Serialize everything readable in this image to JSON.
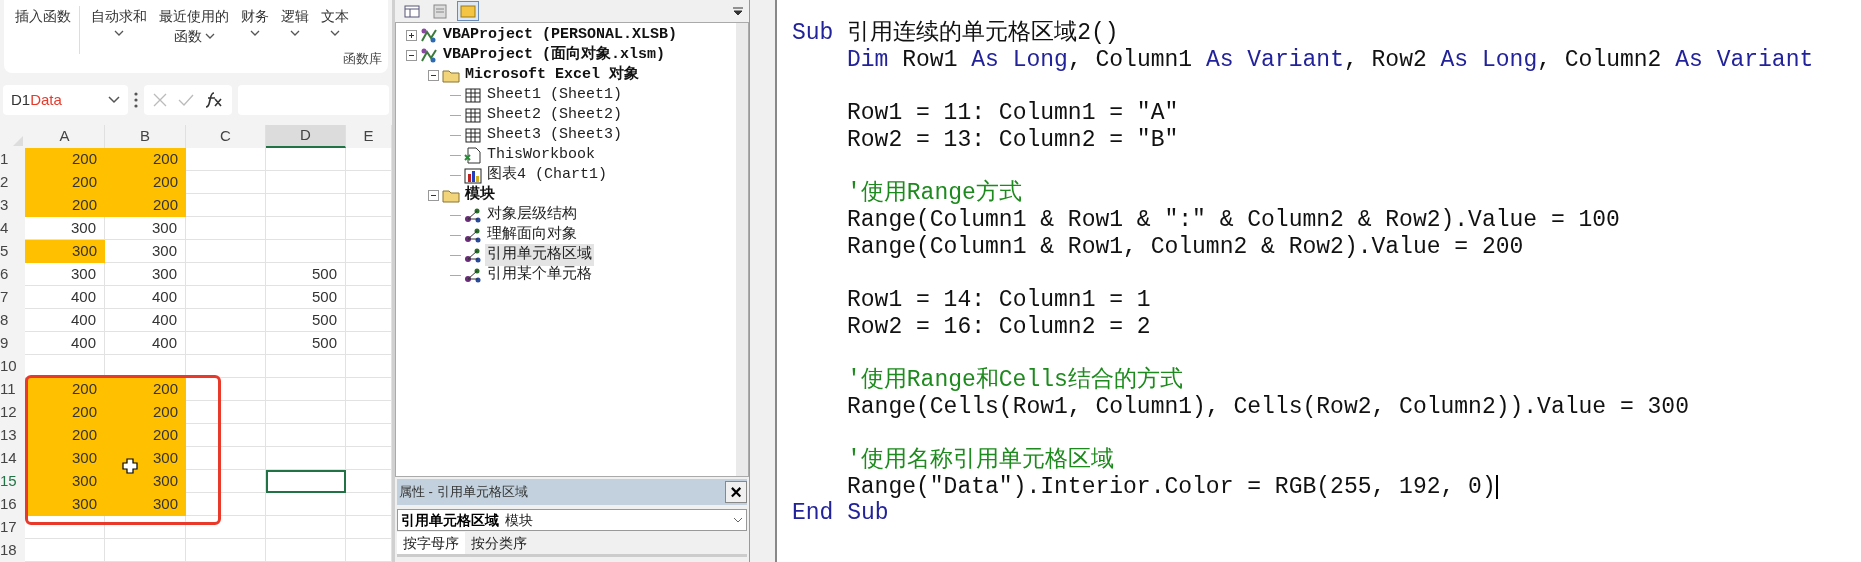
{
  "ribbon": {
    "items": [
      {
        "lines": [
          "插入函数"
        ],
        "dropdown": false
      },
      {
        "lines": [
          "自动求和"
        ],
        "dropdown": true
      },
      {
        "lines": [
          "最近使用的",
          "函数"
        ],
        "dropdown": true
      },
      {
        "lines": [
          "财务"
        ],
        "dropdown": true
      },
      {
        "lines": [
          "逻辑"
        ],
        "dropdown": true
      },
      {
        "lines": [
          "文本"
        ],
        "dropdown": true
      }
    ],
    "group_label": "函数库"
  },
  "name_box": {
    "value": "D1",
    "annotation": "Data"
  },
  "sheet": {
    "columns": [
      {
        "label": "A",
        "selected": false
      },
      {
        "label": "B",
        "selected": false
      },
      {
        "label": "C",
        "selected": false
      },
      {
        "label": "D",
        "selected": true
      },
      {
        "label": "E",
        "selected": false
      }
    ],
    "rows": [
      {
        "label": "1",
        "selected": false,
        "cells": [
          {
            "value": "200",
            "highlighted": true,
            "selected": false
          },
          {
            "value": "200",
            "highlighted": true,
            "selected": false
          },
          {
            "highlighted": false,
            "selected": false
          },
          {
            "highlighted": false,
            "selected": false
          },
          {
            "highlighted": false,
            "selected": false
          }
        ]
      },
      {
        "label": "2",
        "selected": false,
        "cells": [
          {
            "value": "200",
            "highlighted": true,
            "selected": false
          },
          {
            "value": "200",
            "highlighted": true,
            "selected": false
          },
          {
            "highlighted": false,
            "selected": false
          },
          {
            "highlighted": false,
            "selected": false
          },
          {
            "highlighted": false,
            "selected": false
          }
        ]
      },
      {
        "label": "3",
        "selected": false,
        "cells": [
          {
            "value": "200",
            "highlighted": true,
            "selected": false
          },
          {
            "value": "200",
            "highlighted": true,
            "selected": false
          },
          {
            "highlighted": false,
            "selected": false
          },
          {
            "highlighted": false,
            "selected": false
          },
          {
            "highlighted": false,
            "selected": false
          }
        ]
      },
      {
        "label": "4",
        "selected": false,
        "cells": [
          {
            "value": "300",
            "highlighted": false,
            "selected": false
          },
          {
            "value": "300",
            "highlighted": false,
            "selected": false
          },
          {
            "highlighted": false,
            "selected": false
          },
          {
            "highlighted": false,
            "selected": false
          },
          {
            "highlighted": false,
            "selected": false
          }
        ]
      },
      {
        "label": "5",
        "selected": false,
        "cells": [
          {
            "value": "300",
            "highlighted": true,
            "selected": false
          },
          {
            "value": "300",
            "highlighted": false,
            "selected": false
          },
          {
            "highlighted": false,
            "selected": false
          },
          {
            "highlighted": false,
            "selected": false
          },
          {
            "highlighted": false,
            "selected": false
          }
        ]
      },
      {
        "label": "6",
        "selected": false,
        "cells": [
          {
            "value": "300",
            "highlighted": false,
            "selected": false
          },
          {
            "value": "300",
            "highlighted": false,
            "selected": false
          },
          {
            "highlighted": false,
            "selected": false
          },
          {
            "value": "500",
            "highlighted": false,
            "selected": false
          },
          {
            "highlighted": false,
            "selected": false
          }
        ]
      },
      {
        "label": "7",
        "selected": false,
        "cells": [
          {
            "value": "400",
            "highlighted": false,
            "selected": false
          },
          {
            "value": "400",
            "highlighted": false,
            "selected": false
          },
          {
            "highlighted": false,
            "selected": false
          },
          {
            "value": "500",
            "highlighted": false,
            "selected": false
          },
          {
            "highlighted": false,
            "selected": false
          }
        ]
      },
      {
        "label": "8",
        "selected": false,
        "cells": [
          {
            "value": "400",
            "highlighted": false,
            "selected": false
          },
          {
            "value": "400",
            "highlighted": false,
            "selected": false
          },
          {
            "highlighted": false,
            "selected": false
          },
          {
            "value": "500",
            "highlighted": false,
            "selected": false
          },
          {
            "highlighted": false,
            "selected": false
          }
        ]
      },
      {
        "label": "9",
        "selected": false,
        "cells": [
          {
            "value": "400",
            "highlighted": false,
            "selected": false
          },
          {
            "value": "400",
            "highlighted": false,
            "selected": false
          },
          {
            "highlighted": false,
            "selected": false
          },
          {
            "value": "500",
            "highlighted": false,
            "selected": false
          },
          {
            "highlighted": false,
            "selected": false
          }
        ]
      },
      {
        "label": "10",
        "selected": false,
        "cells": [
          {
            "highlighted": false,
            "selected": false
          },
          {
            "highlighted": false,
            "selected": false
          },
          {
            "highlighted": false,
            "selected": false
          },
          {
            "highlighted": false,
            "selected": false
          },
          {
            "highlighted": false,
            "selected": false
          }
        ]
      },
      {
        "label": "11",
        "selected": false,
        "cells": [
          {
            "value": "200",
            "highlighted": true,
            "selected": false
          },
          {
            "value": "200",
            "highlighted": true,
            "selected": false
          },
          {
            "highlighted": false,
            "selected": false
          },
          {
            "highlighted": false,
            "selected": false
          },
          {
            "highlighted": false,
            "selected": false
          }
        ]
      },
      {
        "label": "12",
        "selected": false,
        "cells": [
          {
            "value": "200",
            "highlighted": true,
            "selected": false
          },
          {
            "value": "200",
            "highlighted": true,
            "selected": false
          },
          {
            "highlighted": false,
            "selected": false
          },
          {
            "highlighted": false,
            "selected": false
          },
          {
            "highlighted": false,
            "selected": false
          }
        ]
      },
      {
        "label": "13",
        "selected": false,
        "cells": [
          {
            "value": "200",
            "highlighted": true,
            "selected": false
          },
          {
            "value": "200",
            "highlighted": true,
            "selected": false
          },
          {
            "highlighted": false,
            "selected": false
          },
          {
            "highlighted": false,
            "selected": false
          },
          {
            "highlighted": false,
            "selected": false
          }
        ]
      },
      {
        "label": "14",
        "selected": false,
        "cells": [
          {
            "value": "300",
            "highlighted": true,
            "selected": false
          },
          {
            "value": "300",
            "highlighted": true,
            "selected": false
          },
          {
            "highlighted": false,
            "selected": false
          },
          {
            "highlighted": false,
            "selected": false
          },
          {
            "highlighted": false,
            "selected": false
          }
        ]
      },
      {
        "label": "15",
        "selected": true,
        "cells": [
          {
            "value": "300",
            "highlighted": true,
            "selected": false
          },
          {
            "value": "300",
            "highlighted": true,
            "selected": false
          },
          {
            "highlighted": false,
            "selected": false
          },
          {
            "highlighted": false,
            "selected": true
          },
          {
            "highlighted": false,
            "selected": false
          }
        ]
      },
      {
        "label": "16",
        "selected": false,
        "cells": [
          {
            "value": "300",
            "highlighted": true,
            "selected": false
          },
          {
            "value": "300",
            "highlighted": true,
            "selected": false
          },
          {
            "highlighted": false,
            "selected": false
          },
          {
            "highlighted": false,
            "selected": false
          },
          {
            "highlighted": false,
            "selected": false
          }
        ]
      },
      {
        "label": "17",
        "selected": false,
        "cells": [
          {
            "highlighted": false,
            "selected": false
          },
          {
            "highlighted": false,
            "selected": false
          },
          {
            "highlighted": false,
            "selected": false
          },
          {
            "highlighted": false,
            "selected": false
          },
          {
            "highlighted": false,
            "selected": false
          }
        ]
      },
      {
        "label": "18",
        "selected": false,
        "cells": [
          {
            "highlighted": false,
            "selected": false
          },
          {
            "highlighted": false,
            "selected": false
          },
          {
            "highlighted": false,
            "selected": false
          },
          {
            "highlighted": false,
            "selected": false
          },
          {
            "highlighted": false,
            "selected": false
          }
        ]
      }
    ]
  },
  "project_toolbar": [
    {
      "selected": false
    },
    {
      "selected": false
    },
    {
      "selected": true
    }
  ],
  "project_tree": [
    {
      "kind": "project",
      "label": "VBAProject (PERSONAL.XLSB)",
      "expanded": false,
      "selected": false
    },
    {
      "kind": "project",
      "label": "VBAProject (面向对象.xlsm)",
      "expanded": true,
      "selected": false,
      "children": [
        {
          "kind": "folder",
          "label": "Microsoft Excel 对象",
          "expanded": true,
          "selected": false,
          "children": [
            {
              "kind": "sheet",
              "label": "Sheet1 (Sheet1)",
              "selected": false
            },
            {
              "kind": "sheet",
              "label": "Sheet2 (Sheet2)",
              "selected": false
            },
            {
              "kind": "sheet",
              "label": "Sheet3 (Sheet3)",
              "selected": false
            },
            {
              "kind": "workbook",
              "label": "ThisWorkbook",
              "selected": false
            },
            {
              "kind": "chart",
              "label": "图表4 (Chart1)",
              "selected": false
            }
          ]
        },
        {
          "kind": "folder",
          "label": "模块",
          "expanded": true,
          "selected": false,
          "children": [
            {
              "kind": "module",
              "label": "对象层级结构",
              "selected": false
            },
            {
              "kind": "module",
              "label": "理解面向对象",
              "selected": false
            },
            {
              "kind": "module",
              "label": "引用单元格区域",
              "selected": true
            },
            {
              "kind": "module",
              "label": "引用某个单元格",
              "selected": false
            }
          ]
        }
      ]
    }
  ],
  "properties": {
    "title": "属性 - 引用单元格区域",
    "close": "×",
    "object_name": "引用单元格区域",
    "object_type": "模块",
    "tabs": [
      {
        "label": "按字母序",
        "selected": true
      },
      {
        "label": "按分类序",
        "selected": false
      }
    ]
  },
  "code_lines": [
    {
      "kind": "code",
      "caret": false,
      "indented": false,
      "segments": [
        {
          "kind": "keyword",
          "text": "Sub"
        },
        {
          "kind": "plain",
          "text": " 引用连续的单元格区域2()"
        }
      ]
    },
    {
      "kind": "code",
      "caret": false,
      "indented": true,
      "segments": [
        {
          "kind": "keyword",
          "text": "Dim"
        },
        {
          "kind": "plain",
          "text": " Row1 "
        },
        {
          "kind": "keyword",
          "text": "As Long"
        },
        {
          "kind": "plain",
          "text": ", Column1 "
        },
        {
          "kind": "keyword",
          "text": "As Variant"
        },
        {
          "kind": "plain",
          "text": ", Row2 "
        },
        {
          "kind": "keyword",
          "text": "As Long"
        },
        {
          "kind": "plain",
          "text": ", Column2 "
        },
        {
          "kind": "keyword",
          "text": "As Variant"
        }
      ]
    },
    {
      "kind": "blank"
    },
    {
      "kind": "code",
      "caret": false,
      "indented": true,
      "segments": [
        {
          "kind": "plain",
          "text": "Row1 = 11: Column1 = \"A\""
        }
      ]
    },
    {
      "kind": "code",
      "caret": false,
      "indented": true,
      "segments": [
        {
          "kind": "plain",
          "text": "Row2 = 13: Column2 = \"B\""
        }
      ]
    },
    {
      "kind": "blank"
    },
    {
      "kind": "code",
      "caret": false,
      "indented": true,
      "segments": [
        {
          "kind": "comment",
          "text": "'使用Range方式"
        }
      ]
    },
    {
      "kind": "code",
      "caret": false,
      "indented": true,
      "segments": [
        {
          "kind": "plain",
          "text": "Range(Column1 & Row1 & \":\" & Column2 & Row2).Value = 100"
        }
      ]
    },
    {
      "kind": "code",
      "caret": false,
      "indented": true,
      "segments": [
        {
          "kind": "plain",
          "text": "Range(Column1 & Row1, Column2 & Row2).Value = 200"
        }
      ]
    },
    {
      "kind": "blank"
    },
    {
      "kind": "code",
      "caret": false,
      "indented": true,
      "segments": [
        {
          "kind": "plain",
          "text": "Row1 = 14: Column1 = 1"
        }
      ]
    },
    {
      "kind": "code",
      "caret": false,
      "indented": true,
      "segments": [
        {
          "kind": "plain",
          "text": "Row2 = 16: Column2 = 2"
        }
      ]
    },
    {
      "kind": "blank"
    },
    {
      "kind": "code",
      "caret": false,
      "indented": true,
      "segments": [
        {
          "kind": "comment",
          "text": "'使用Range和Cells结合的方式"
        }
      ]
    },
    {
      "kind": "code",
      "caret": false,
      "indented": true,
      "segments": [
        {
          "kind": "plain",
          "text": "Range(Cells(Row1, Column1), Cells(Row2, Column2)).Value = 300"
        }
      ]
    },
    {
      "kind": "blank"
    },
    {
      "kind": "code",
      "caret": false,
      "indented": true,
      "segments": [
        {
          "kind": "comment",
          "text": "'使用名称引用单元格区域"
        }
      ]
    },
    {
      "kind": "code",
      "caret": true,
      "indented": true,
      "segments": [
        {
          "kind": "plain",
          "text": "Range(\"Data\").Interior.Color = RGB(255, 192, 0)"
        }
      ]
    },
    {
      "kind": "code",
      "caret": false,
      "indented": false,
      "segments": [
        {
          "kind": "keyword",
          "text": "End Sub"
        }
      ]
    }
  ]
}
